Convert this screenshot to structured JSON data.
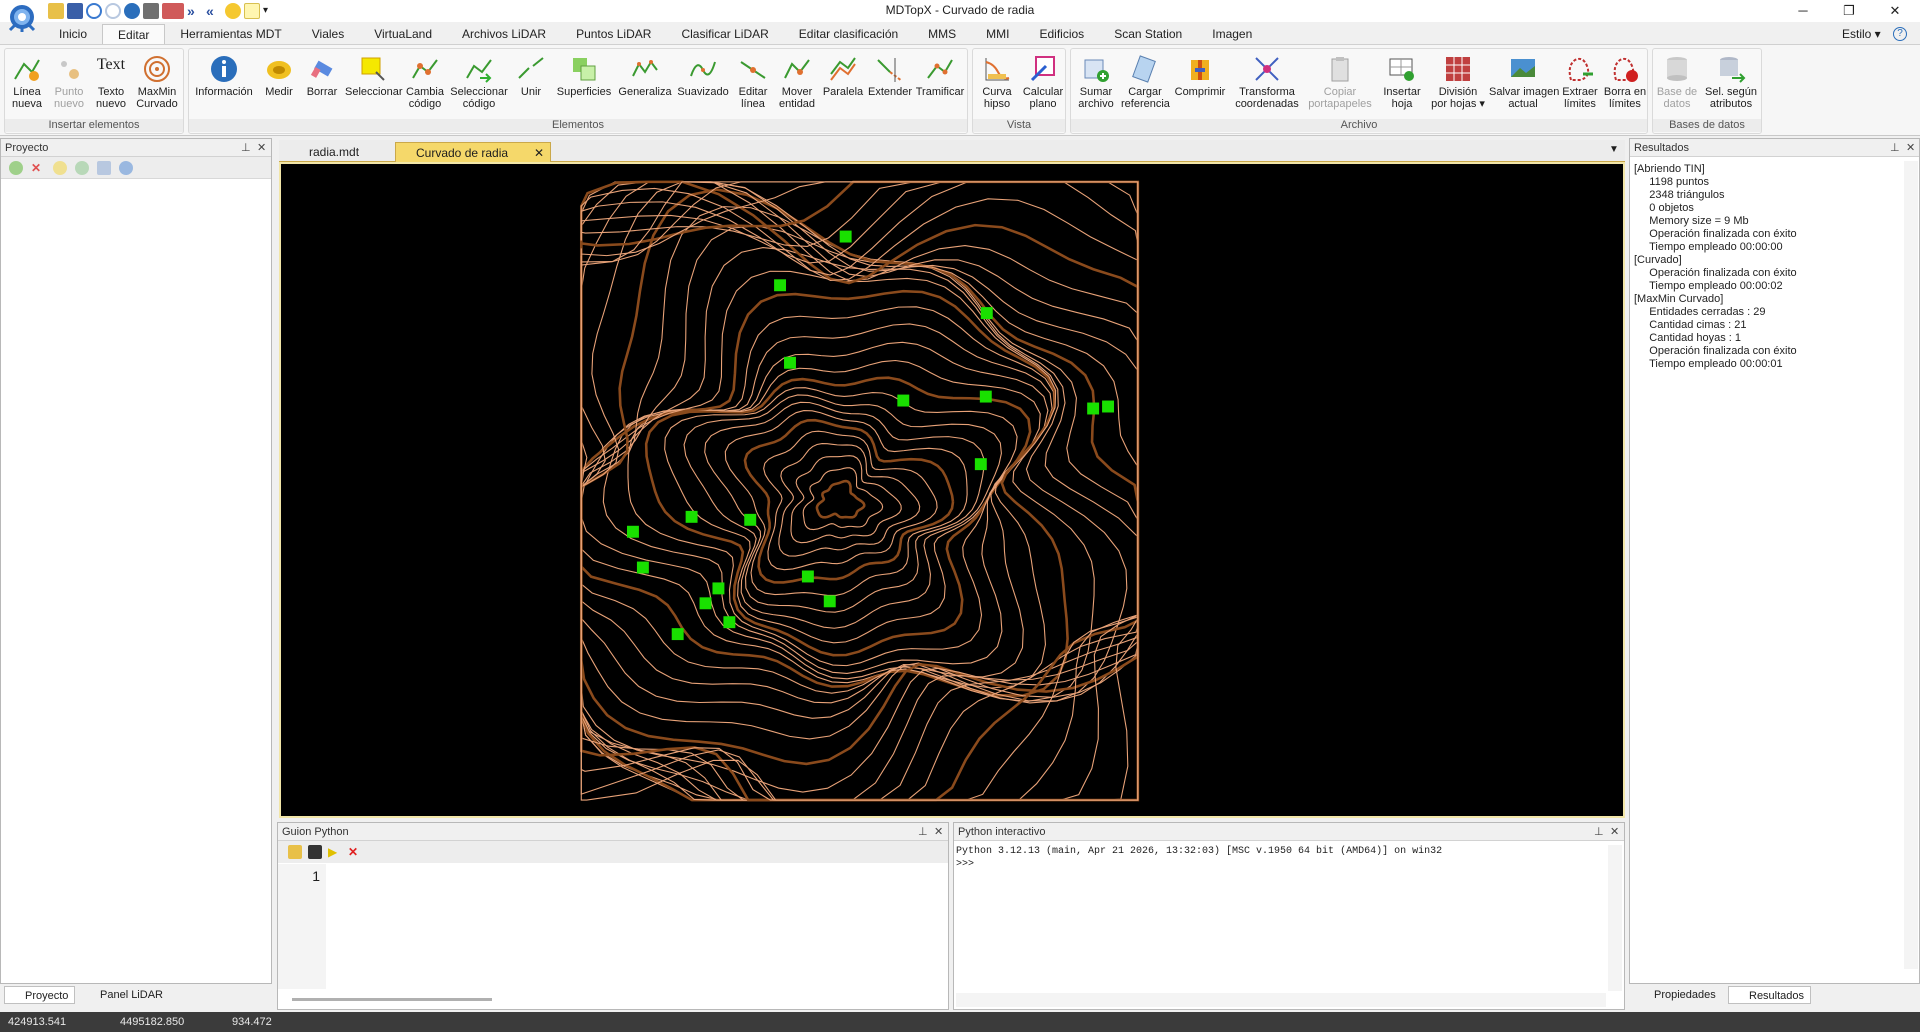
{
  "window": {
    "title": "MDTopX - Curvado de radia",
    "minimize": "─",
    "maximize": "❐",
    "close": "✕"
  },
  "tabs": [
    "Inicio",
    "Editar",
    "Herramientas MDT",
    "Viales",
    "VirtuaLand",
    "Archivos LiDAR",
    "Puntos LiDAR",
    "Clasificar LiDAR",
    "Editar clasificación",
    "MMS",
    "MMI",
    "Edificios",
    "Scan Station",
    "Imagen"
  ],
  "active_tab": "Editar",
  "estilo": "Estilo ▾",
  "help": "?",
  "ribbon": {
    "groups": [
      {
        "label": "Insertar elementos",
        "buttons": [
          "Línea\nnueva",
          "Punto\nnuevo",
          "Texto\nnuevo",
          "MaxMin\nCurvado"
        ]
      },
      {
        "label": "Elementos",
        "buttons": [
          "Información",
          "Medir",
          "Borrar",
          "Seleccionar",
          "Cambia\ncódigo",
          "Seleccionar\ncódigo",
          "Unir",
          "Superficies",
          "Generaliza",
          "Suavizado",
          "Editar\nlínea",
          "Mover\nentidad",
          "Paralela",
          "Extender",
          "Tramificar"
        ]
      },
      {
        "label": "Vista",
        "buttons": [
          "Curva\nhipso",
          "Calcular\nplano"
        ]
      },
      {
        "label": "Archivo",
        "buttons": [
          "Sumar\narchivo",
          "Cargar\nreferencia",
          "Comprimir",
          "Transforma\ncoordenadas",
          "Copiar\nportapapeles",
          "Insertar\nhoja",
          "División\npor hojas ▾",
          "Salvar imagen\nactual",
          "Extraer\nlímites",
          "Borra en\nlímites"
        ]
      },
      {
        "label": "Bases de datos",
        "buttons": [
          "Base de\ndatos",
          "Sel. según\natributos"
        ]
      }
    ],
    "texto_icon_label": "Text"
  },
  "left_panel": {
    "title": "Proyecto",
    "tabs": [
      "Proyecto",
      "Panel LiDAR"
    ]
  },
  "doc_tabs": [
    "radia.mdt",
    "Curvado de radia"
  ],
  "python_script": {
    "title": "Guion Python",
    "line_number": "1"
  },
  "python_interactive": {
    "title": "Python interactivo",
    "lines": [
      "Python 3.12.13 (main, Apr 21 2026, 13:32:03) [MSC v.1950 64 bit (AMD64)] on win32",
      ">>>"
    ]
  },
  "results": {
    "title": "Resultados",
    "lines": [
      "[Abriendo TIN]",
      "     1198 puntos",
      "     2348 triángulos",
      "     0 objetos",
      "     Memory size = 9 Mb",
      "     Operación finalizada con éxito",
      "     Tiempo empleado 00:00:00",
      "[Curvado]",
      "     Operación finalizada con éxito",
      "     Tiempo empleado 00:00:02",
      "[MaxMin Curvado]",
      "     Entidades cerradas : 29",
      "     Cantidad cimas : 21",
      "     Cantidad hoyas : 1",
      "     Operación finalizada con éxito",
      "     Tiempo empleado 00:00:01"
    ],
    "tabs": [
      "Propiedades",
      "Resultados"
    ]
  },
  "status": {
    "x": "424913.541",
    "y": "4495182.850",
    "z": "934.472"
  },
  "colors": {
    "accent": "#f5d86a",
    "contour_major": "#8a4a1c",
    "contour_minor": "#e8a278",
    "marker": "#19e000"
  }
}
